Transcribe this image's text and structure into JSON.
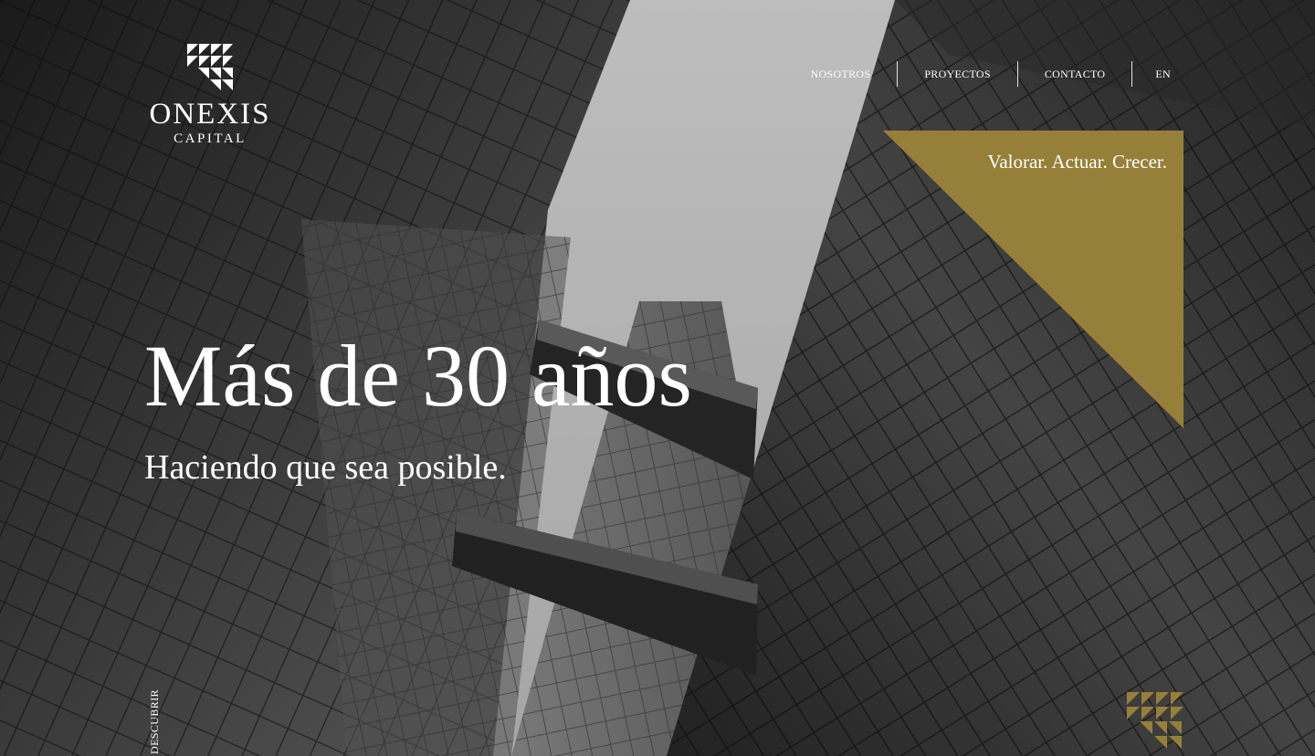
{
  "brand": {
    "name": "ONEXIS",
    "sub": "CAPITAL",
    "logo_icon": "triangle-grid-icon"
  },
  "nav": {
    "items": [
      {
        "label": "NOSOTROS"
      },
      {
        "label": "PROYECTOS"
      },
      {
        "label": "CONTACTO"
      },
      {
        "label": "EN"
      }
    ]
  },
  "hero": {
    "tagline": "Valorar. Actuar. Crecer.",
    "headline": "Más de 30 años",
    "subheadline": "Haciendo que sea posible.",
    "discover_label": "DESCUBRIR",
    "background_icon": "skyscrapers-photo"
  },
  "colors": {
    "accent_gold": "#968039",
    "text": "#ffffff"
  },
  "footer_mark_icon": "triangle-grid-gold-icon"
}
